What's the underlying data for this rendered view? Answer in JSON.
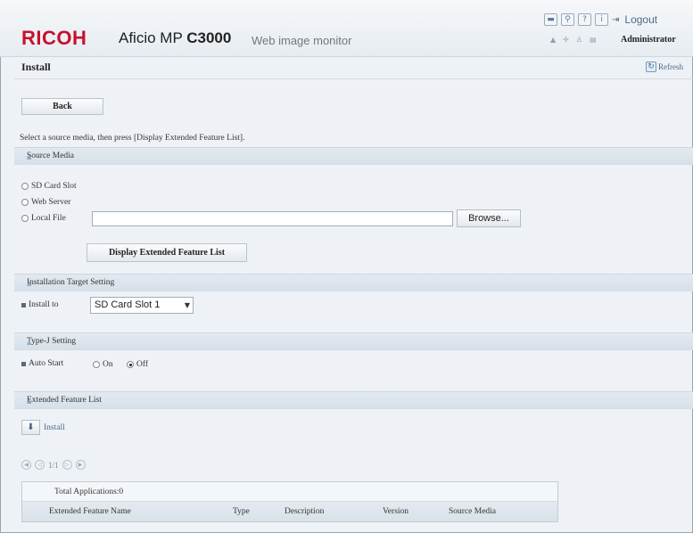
{
  "header": {
    "brand": "RICOH",
    "model_prefix": "Aficio MP",
    "model_bold": "C3000",
    "subtitle": "Web image monitor",
    "logout": "Logout",
    "user": "Administrator"
  },
  "page": {
    "title": "Install",
    "refresh": "Refresh",
    "back": "Back",
    "instruction": "Select a source media, then press [Display Extended Feature List]."
  },
  "source_media": {
    "heading": "Source Media",
    "options": [
      "SD Card Slot",
      "Web Server",
      "Local File"
    ],
    "file_value": "",
    "browse": "Browse...",
    "display_button": "Display Extended Feature List"
  },
  "install_target": {
    "heading": "Installation Target Setting",
    "label": "Install to",
    "selected": "SD Card Slot 1"
  },
  "typej": {
    "heading": "Type-J Setting",
    "label": "Auto Start",
    "on": "On",
    "off": "Off",
    "selected": "Off"
  },
  "extended": {
    "heading": "Extended Feature List",
    "install": "Install",
    "page": "1/1",
    "total": "Total Applications:0",
    "columns": [
      "Extended Feature Name",
      "Type",
      "Description",
      "Version",
      "Source Media"
    ]
  }
}
